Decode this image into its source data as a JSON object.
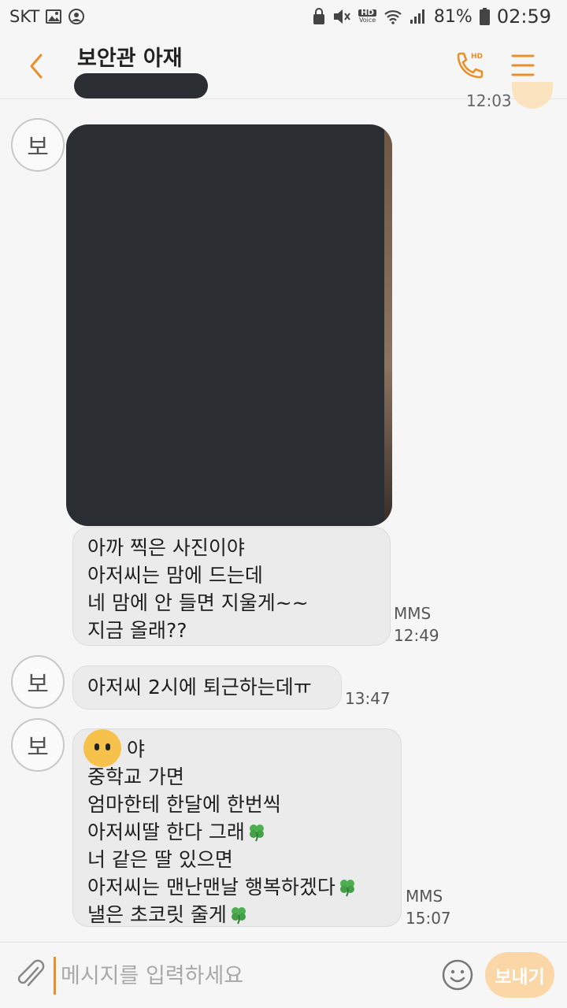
{
  "status_bar": {
    "carrier": "SKT",
    "hd_label": "HD",
    "voice_label": "Voice",
    "battery_percent": "81%",
    "time": "02:59"
  },
  "header": {
    "title": "보안관 아재",
    "call_hd_label": "HD"
  },
  "conversation": {
    "partial_time": "12:03",
    "avatar_initial": "보",
    "messages": [
      {
        "lines": [
          "아까 찍은 사진이야",
          "아저씨는 맘에 드는데",
          "네 맘에 안 들면 지울게~~",
          "지금 올래??"
        ],
        "type_label": "MMS",
        "time": "12:49"
      },
      {
        "text": "아저씨 2시에 퇴근하는데ㅠ",
        "time": "13:47"
      },
      {
        "lines": [
          "야",
          "중학교 가면",
          "엄마한테 한달에 한번씩",
          "아저씨딸 한다 그래",
          "너 같은 딸 있으면",
          "아저씨는 맨난맨날 행복하겠다",
          "낼은 초코릿 줄게"
        ],
        "type_label": "MMS",
        "time": "15:07"
      }
    ]
  },
  "composer": {
    "placeholder": "메시지를 입력하세요",
    "send_label": "보내기"
  },
  "colors": {
    "accent": "#e8902a",
    "bubble_bg": "#ebebeb",
    "send_button_bg": "#fbd6a6",
    "redaction": "#2a2d31"
  },
  "icons": [
    "image-icon",
    "face-icon",
    "lock-icon",
    "mute-icon",
    "wifi-icon",
    "signal-icon",
    "battery-icon",
    "back-icon",
    "phone-icon",
    "menu-icon",
    "clover-icon",
    "paperclip-icon",
    "smiley-icon"
  ]
}
